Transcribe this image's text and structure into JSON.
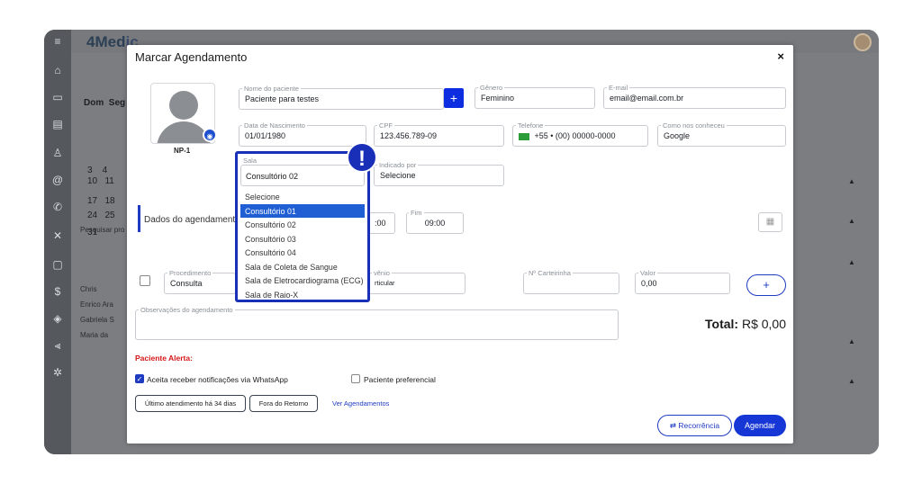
{
  "background": {
    "logo_main": "4Med",
    "logo_accent": "ic",
    "week_days": "Dom  Seg",
    "cal_rows": [
      "3    4",
      "10   11",
      "17   18",
      "24   25",
      "31"
    ],
    "search_placeholder": "Pesquisar pro",
    "patients": [
      "Chris",
      "Enrico Ara",
      "Gabriela S",
      "Maria da"
    ]
  },
  "modal": {
    "title": "Marcar Agendamento",
    "close": "×"
  },
  "patient": {
    "photo_caption": "NP-1",
    "name_label": "Nome do paciente",
    "name_value": "Paciente para testes",
    "add_symbol": "+",
    "gender_label": "Gênero",
    "gender_value": "Feminino",
    "email_label": "E-mail",
    "email_value": "email@email.com.br",
    "birth_label": "Data de Nascimento",
    "birth_value": "01/01/1980",
    "cpf_label": "CPF",
    "cpf_value": "123.456.789-09",
    "phone_label": "Telefone",
    "phone_value": "+55 •  (00) 00000-0000",
    "source_label": "Como nos conheceu",
    "source_value": "Google",
    "room_label": "Sala",
    "room_value": "Consultório 02",
    "referred_label": "Indicado por",
    "referred_value": "Selecione"
  },
  "room_options": [
    "Selecione",
    "Consultório 01",
    "Consultório 02",
    "Consultório 03",
    "Consultório 04",
    "Sala de Coleta de Sangue",
    "Sala de Eletrocardiograma (ECG)",
    "Sala de Raio-X"
  ],
  "alert_symbol": "!",
  "appointment": {
    "section_title": "Dados do agendamento",
    "start_value": ":00",
    "end_label": "Fim",
    "end_value": "09:00"
  },
  "procedure": {
    "proc_label": "Procedimento",
    "proc_value": "Consulta",
    "insurance_label": "vênio",
    "insurance_value": "rticular",
    "card_label": "Nº Carteirinha",
    "value_label": "Valor",
    "value_value": "0,00",
    "add_symbol": "+"
  },
  "notes_label": "Observações do agendamento",
  "total_label": "Total:",
  "total_value": "R$ 0,00",
  "alert_label": "Paciente Alerta:",
  "whatsapp_label": "Aceita receber notificações via WhatsApp",
  "preferential_label": "Paciente preferencial",
  "last_visit_button": "Último atendimento há 34 dias",
  "return_button": "Fora do Retorno",
  "view_appointments_link": "Ver Agendamentos",
  "recurrence_button": "Recorrência",
  "schedule_button": "Agendar",
  "colors": {
    "primary": "#1636d6",
    "highlight_border": "#1a2fb8",
    "alert_red": "#d41616"
  }
}
